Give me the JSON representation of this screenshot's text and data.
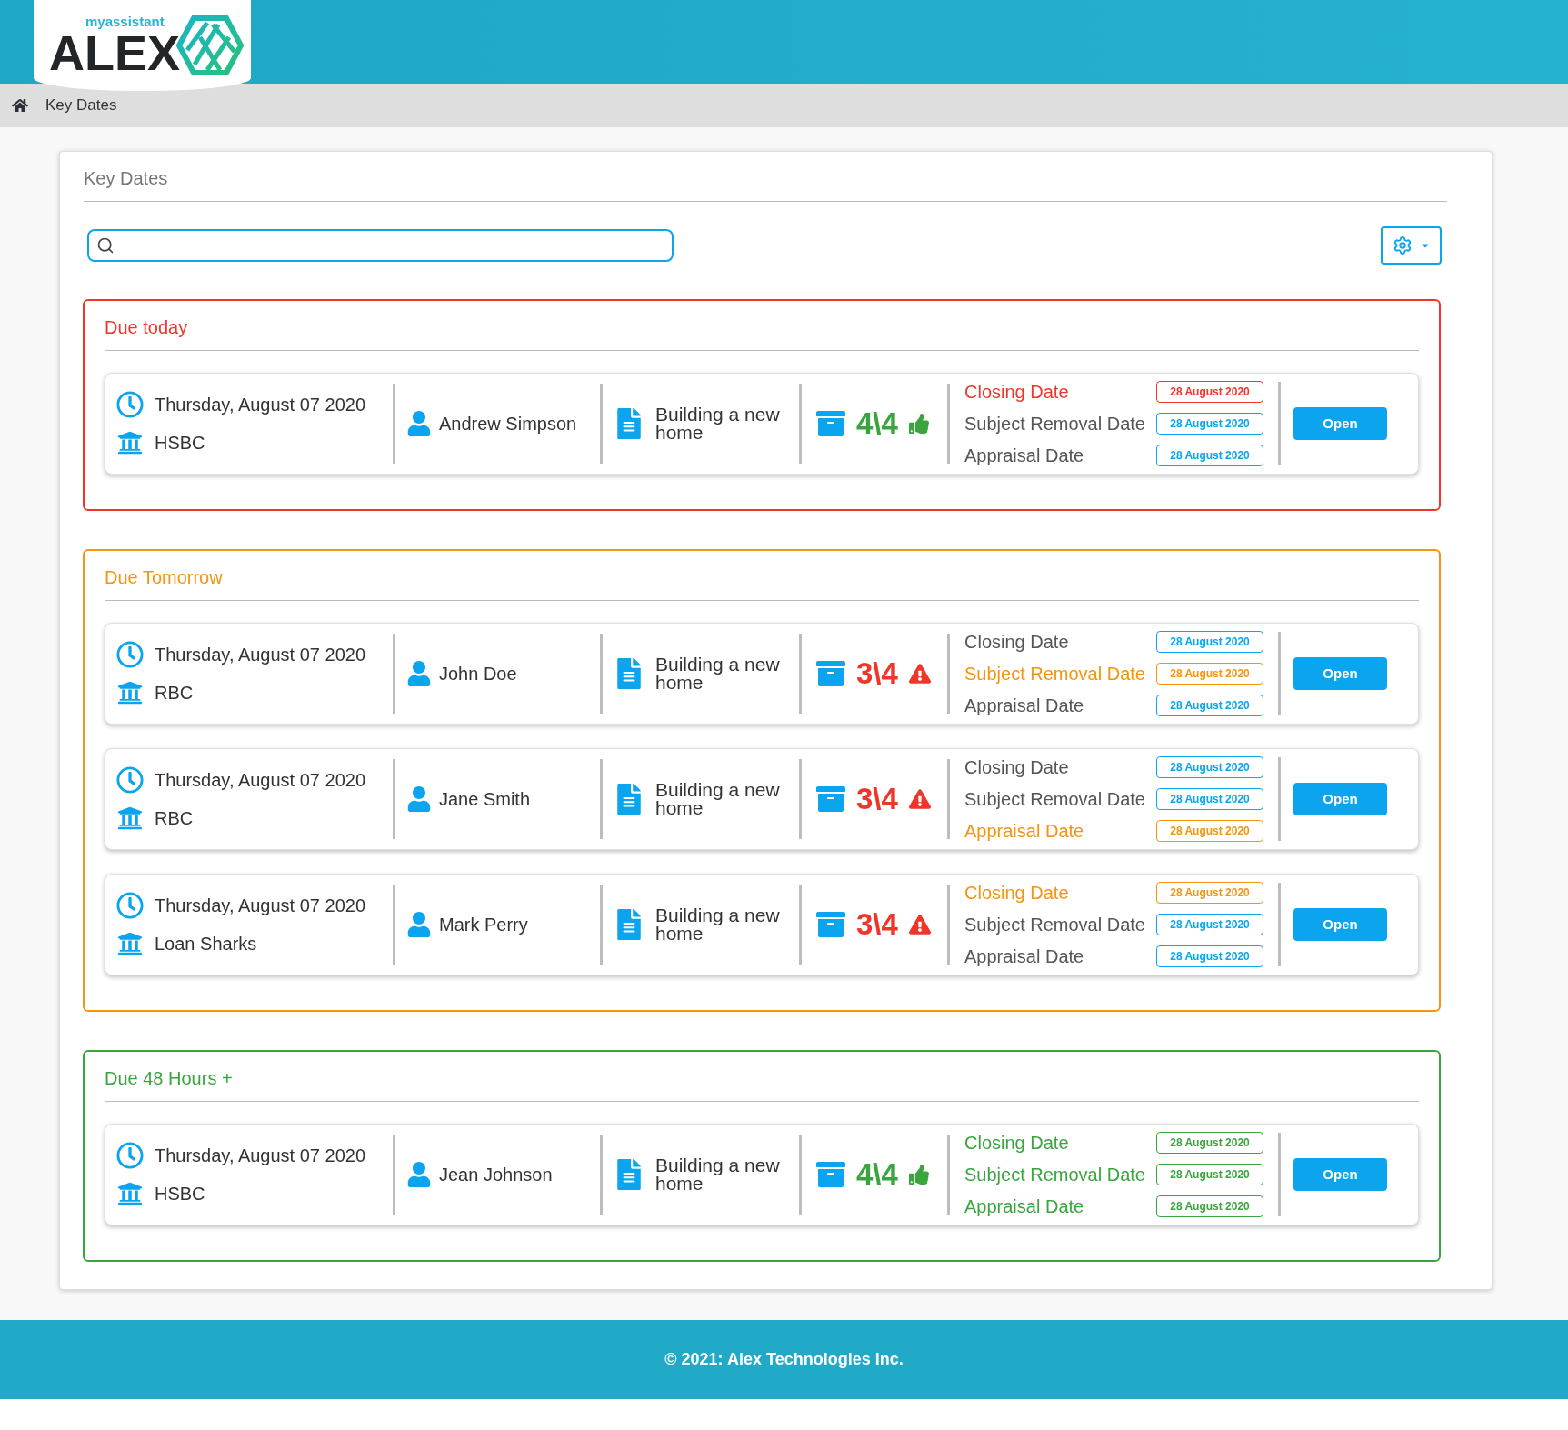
{
  "logo": {
    "tagline": "myassistant",
    "name": "ALEX"
  },
  "breadcrumb": {
    "label": "Key Dates"
  },
  "panel": {
    "title": "Key Dates"
  },
  "sections": [
    {
      "title": "Due today",
      "color": "#f0362a",
      "items": [
        {
          "date": "Thursday, August 07 2020",
          "lender": "HSBC",
          "client": "Andrew Simpson",
          "project": "Building a new home",
          "score": "4\\4",
          "kind": "ok",
          "key_dates": [
            {
              "label": "Closing Date",
              "date": "28 August 2020",
              "highlighted": true
            },
            {
              "label": "Subject Removal Date",
              "date": "28 August 2020",
              "highlighted": false
            },
            {
              "label": "Appraisal Date",
              "date": "28 August 2020",
              "highlighted": false
            }
          ],
          "button": "Open"
        }
      ]
    },
    {
      "title": "Due Tomorrow",
      "color": "#f5940f",
      "items": [
        {
          "date": "Thursday, August 07 2020",
          "lender": "RBC",
          "client": "John Doe",
          "project": "Building a new home",
          "score": "3\\4",
          "kind": "warning",
          "key_dates": [
            {
              "label": "Closing Date",
              "date": "28 August 2020",
              "highlighted": false
            },
            {
              "label": "Subject Removal Date",
              "date": "28 August 2020",
              "highlighted": true
            },
            {
              "label": "Appraisal Date",
              "date": "28 August 2020",
              "highlighted": false
            }
          ],
          "button": "Open"
        },
        {
          "date": "Thursday, August 07 2020",
          "lender": "RBC",
          "client": "Jane Smith",
          "project": "Building a new home",
          "score": "3\\4",
          "kind": "warning",
          "key_dates": [
            {
              "label": "Closing Date",
              "date": "28 August 2020",
              "highlighted": false
            },
            {
              "label": "Subject Removal Date",
              "date": "28 August 2020",
              "highlighted": false
            },
            {
              "label": "Appraisal Date",
              "date": "28 August 2020",
              "highlighted": true
            }
          ],
          "button": "Open"
        },
        {
          "date": "Thursday, August 07 2020",
          "lender": "Loan Sharks",
          "client": "Mark Perry",
          "project": "Building a new home",
          "score": "3\\4",
          "kind": "warning",
          "key_dates": [
            {
              "label": "Closing Date",
              "date": "28 August 2020",
              "highlighted": true
            },
            {
              "label": "Subject Removal Date",
              "date": "28 August 2020",
              "highlighted": false
            },
            {
              "label": "Appraisal Date",
              "date": "28 August 2020",
              "highlighted": false
            }
          ],
          "button": "Open"
        }
      ]
    },
    {
      "title": "Due 48 Hours +",
      "color": "#3aa53e",
      "items": [
        {
          "date": "Thursday, August 07 2020",
          "lender": "HSBC",
          "client": "Jean Johnson",
          "project": "Building a new home",
          "score": "4\\4",
          "kind": "ok",
          "key_dates": [
            {
              "label": "Closing Date",
              "date": "28 August 2020",
              "highlighted": true
            },
            {
              "label": "Subject Removal Date",
              "date": "28 August 2020",
              "highlighted": true
            },
            {
              "label": "Appraisal Date",
              "date": "28 August 2020",
              "highlighted": true
            }
          ],
          "button": "Open"
        }
      ]
    }
  ],
  "footer": {
    "text": "© 2021: Alex Technologies Inc."
  }
}
